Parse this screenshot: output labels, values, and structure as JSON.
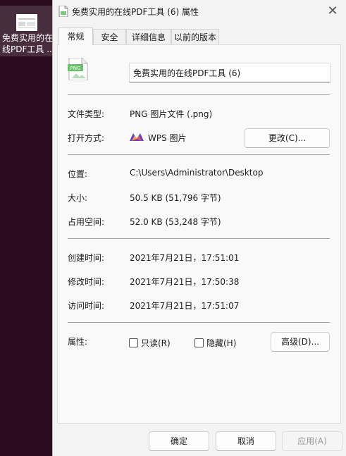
{
  "desktop": {
    "icon_label_line1": "免费实用的在",
    "icon_label_line2": "线PDF工具 ..."
  },
  "dialog": {
    "title": "免费实用的在线PDF工具 (6) 属性",
    "close_glyph": "✕",
    "tabs": [
      {
        "label": "常规",
        "active": true
      },
      {
        "label": "安全",
        "active": false
      },
      {
        "label": "详细信息",
        "active": false
      },
      {
        "label": "以前的版本",
        "active": false
      }
    ],
    "file_icon_label": "PNG",
    "file_name": "免费实用的在线PDF工具 (6)",
    "rows": {
      "type_label": "文件类型:",
      "type_value": "PNG 图片文件 (.png)",
      "open_label": "打开方式:",
      "open_value": "WPS 图片",
      "change_button": "更改(C)...",
      "location_label": "位置:",
      "location_value": "C:\\Users\\Administrator\\Desktop",
      "size_label": "大小:",
      "size_value": "50.5 KB (51,796 字节)",
      "disk_label": "占用空间:",
      "disk_value": "52.0 KB (53,248 字节)",
      "created_label": "创建时间:",
      "created_value": "2021年7月21日，17:51:01",
      "modified_label": "修改时间:",
      "modified_value": "2021年7月21日，17:50:38",
      "accessed_label": "访问时间:",
      "accessed_value": "2021年7月21日，17:51:07",
      "attr_label": "属性:",
      "readonly_label": "只读(R)",
      "hidden_label": "隐藏(H)",
      "advanced_button": "高级(D)..."
    },
    "footer": {
      "ok": "确定",
      "cancel": "取消",
      "apply": "应用(A)"
    }
  }
}
